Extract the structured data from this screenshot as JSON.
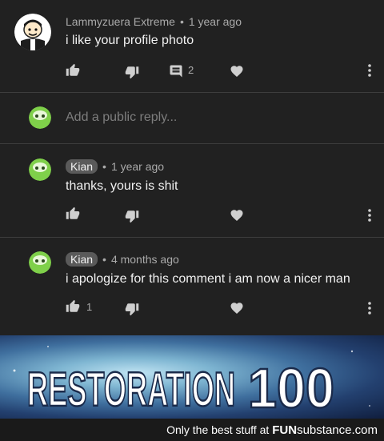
{
  "comment": {
    "author": "Lammyzuera Extreme",
    "time": "1 year ago",
    "text": "i like your profile photo",
    "reply_count": "2"
  },
  "reply_box": {
    "placeholder": "Add a public reply..."
  },
  "replies": [
    {
      "author": "Kian",
      "time": "1 year ago",
      "text": "thanks, yours is shit",
      "like_count": ""
    },
    {
      "author": "Kian",
      "time": "4 months ago",
      "text": "i apologize for this comment i am now a nicer man",
      "like_count": "1"
    }
  ],
  "separator": "•",
  "banner": {
    "text_left": "RESTORATION",
    "text_right": "100"
  },
  "footer": {
    "text": "Only the best stuff at",
    "brand_bold": "FUN",
    "brand_rest": "substance",
    "brand_tld": ".com"
  },
  "colors": {
    "background": "#212121",
    "meta": "#aaaaaa",
    "badge": "#5a5a5a",
    "avatar_green": "#7fd04a"
  },
  "icons": [
    "thumbs-up-icon",
    "thumbs-down-icon",
    "comment-icon",
    "heart-icon",
    "more-vertical-icon"
  ]
}
